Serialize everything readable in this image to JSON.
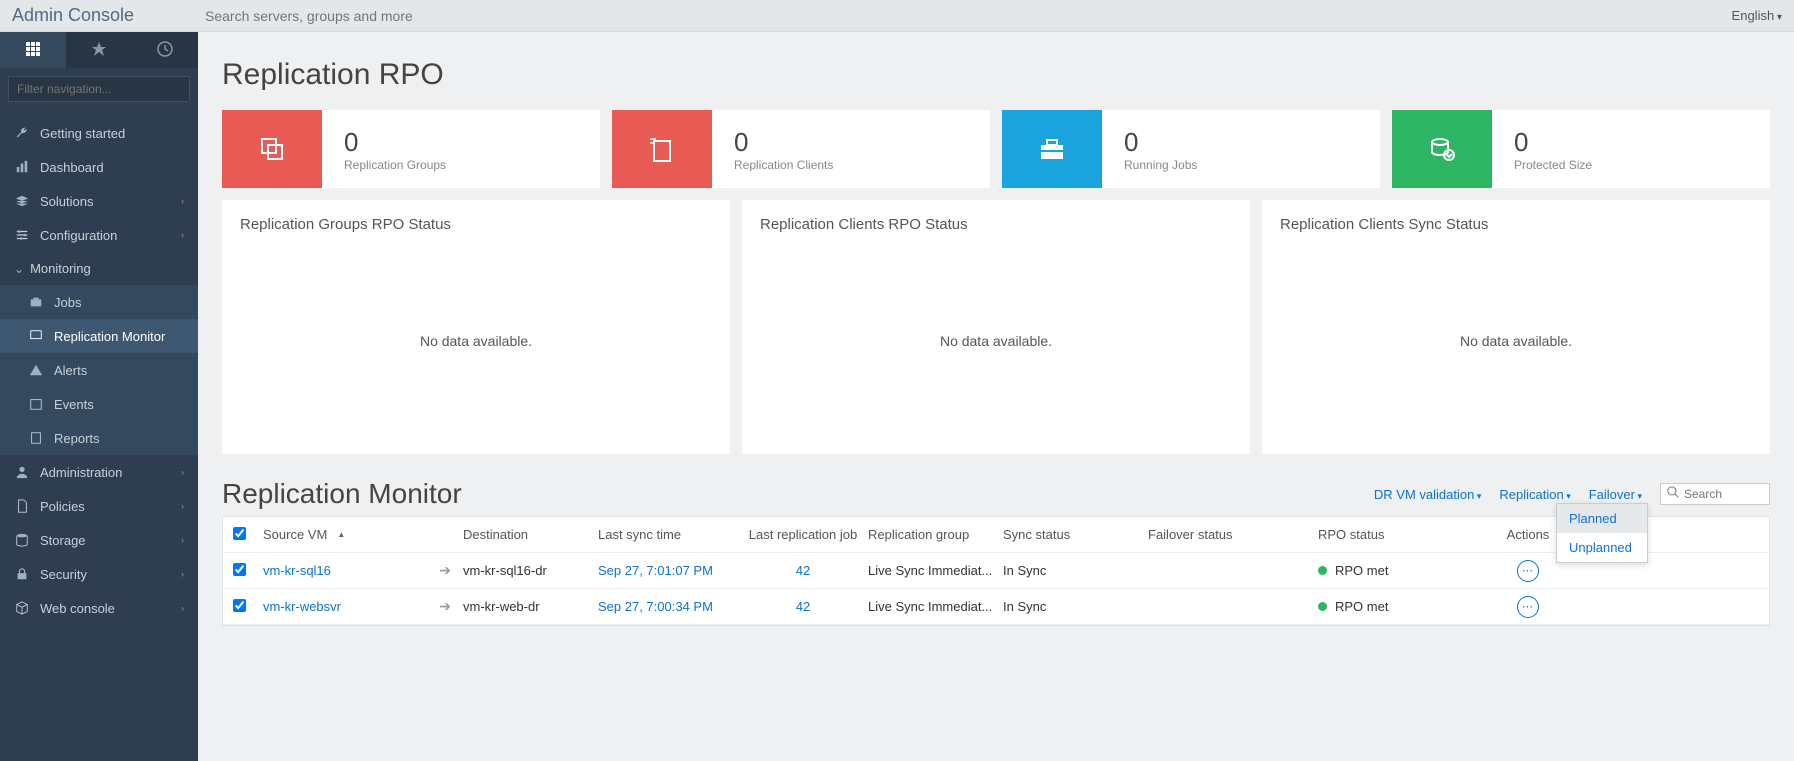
{
  "header": {
    "app_title": "Admin Console",
    "search_placeholder": "Search servers, groups and more",
    "language": "English"
  },
  "sidebar": {
    "filter_placeholder": "Filter navigation...",
    "items": [
      {
        "label": "Getting started"
      },
      {
        "label": "Dashboard"
      },
      {
        "label": "Solutions"
      },
      {
        "label": "Configuration"
      },
      {
        "label": "Monitoring"
      },
      {
        "label": "Jobs"
      },
      {
        "label": "Replication Monitor"
      },
      {
        "label": "Alerts"
      },
      {
        "label": "Events"
      },
      {
        "label": "Reports"
      },
      {
        "label": "Administration"
      },
      {
        "label": "Policies"
      },
      {
        "label": "Storage"
      },
      {
        "label": "Security"
      },
      {
        "label": "Web console"
      }
    ]
  },
  "page": {
    "title": "Replication RPO",
    "stats": [
      {
        "value": "0",
        "label": "Replication Groups"
      },
      {
        "value": "0",
        "label": "Replication Clients"
      },
      {
        "value": "0",
        "label": "Running Jobs"
      },
      {
        "value": "0",
        "label": "Protected Size"
      }
    ],
    "panels": [
      {
        "title": "Replication Groups RPO Status",
        "body": "No data available."
      },
      {
        "title": "Replication Clients RPO Status",
        "body": "No data available."
      },
      {
        "title": "Replication Clients Sync Status",
        "body": "No data available."
      }
    ]
  },
  "monitor": {
    "title": "Replication Monitor",
    "actions": {
      "dr_vm": "DR VM validation",
      "replication": "Replication",
      "failover": "Failover",
      "search_placeholder": "Search"
    },
    "failover_menu": {
      "planned": "Planned",
      "unplanned": "Unplanned"
    },
    "columns": {
      "source": "Source VM",
      "dest": "Destination",
      "last_sync": "Last sync time",
      "last_job": "Last replication job",
      "group": "Replication group",
      "sync_status": "Sync status",
      "failover_status": "Failover status",
      "rpo_status": "RPO status",
      "actions": "Actions"
    },
    "rows": [
      {
        "source": "vm-kr-sql16",
        "dest": "vm-kr-sql16-dr",
        "last_sync": "Sep 27, 7:01:07 PM",
        "last_job": "42",
        "group": "Live Sync Immediat...",
        "sync_status": "In Sync",
        "failover_status": "",
        "rpo_status": "RPO met"
      },
      {
        "source": "vm-kr-websvr",
        "dest": "vm-kr-web-dr",
        "last_sync": "Sep 27, 7:00:34 PM",
        "last_job": "42",
        "group": "Live Sync Immediat...",
        "sync_status": "In Sync",
        "failover_status": "",
        "rpo_status": "RPO met"
      }
    ]
  }
}
